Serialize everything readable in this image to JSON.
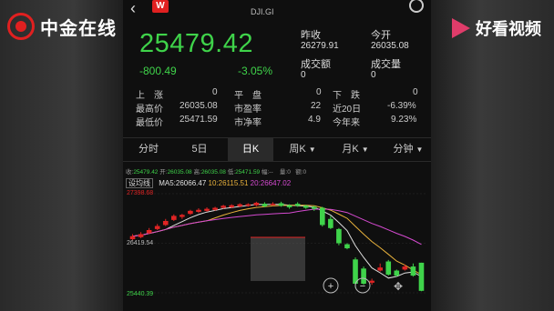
{
  "watermarks": {
    "left_text": "中金在线",
    "right_text": "好看视频"
  },
  "header": {
    "badge": "W",
    "symbol": "DJI.GI"
  },
  "quote": {
    "price": "25479.42",
    "change": "-800.49",
    "change_pct": "-3.05%",
    "prev_close_label": "昨收",
    "prev_close": "26279.91",
    "open_label": "今开",
    "open": "26035.08",
    "turnover_label": "成交额",
    "turnover": "0",
    "volume_label": "成交量",
    "volume": "0"
  },
  "stats": {
    "up_label": "上　涨",
    "up": "0",
    "flat_label": "平　盘",
    "flat": "0",
    "down_label": "下　跌",
    "down": "0",
    "high_label": "最高价",
    "high": "26035.08",
    "pe_label": "市盈率",
    "pe": "22",
    "d20_label": "近20日",
    "d20": "-6.39%",
    "low_label": "最低价",
    "low": "25471.59",
    "pb_label": "市净率",
    "pb": "4.9",
    "ytd_label": "今年来",
    "ytd": "9.23%"
  },
  "tabs": [
    {
      "label": "分时",
      "active": false
    },
    {
      "label": "5日",
      "active": false
    },
    {
      "label": "日K",
      "active": true
    },
    {
      "label": "周K",
      "active": false
    },
    {
      "label": "月K",
      "active": false
    },
    {
      "label": "分钟",
      "active": false
    }
  ],
  "kline_header": {
    "close_label": "收:",
    "close": "25479.42",
    "open_label": "开:",
    "open": "26035.08",
    "high_label": "高:",
    "high": "26035.08",
    "low_label": "低:",
    "low": "25471.59",
    "extra": "幅:--",
    "vol_label": "量:",
    "vol": "0",
    "amount_label": "额:",
    "amount": "0"
  },
  "ma": {
    "btn": "设均线",
    "ma5": "MA5:26066.47",
    "ma10": "10:26115.51",
    "ma20": "20:26647.02"
  },
  "chart_labels": {
    "top": "27398.68",
    "mid": "26419.54",
    "bottom": "25440.39"
  },
  "controls": {
    "zoom_in": "+",
    "zoom_out": "−"
  },
  "colors": {
    "up": "#e02424",
    "down": "#3fd34a",
    "ma5": "#e0e0e0",
    "ma10": "#e9b23c",
    "ma20": "#d54ad0",
    "accent": "#e02020"
  },
  "chart_data": {
    "type": "candlestick",
    "ylim": [
      25440.39,
      27398.68
    ],
    "labels": [
      "27398.68",
      "26419.54",
      "25440.39"
    ],
    "candles": [
      {
        "o": 26500,
        "c": 26560,
        "h": 26600,
        "l": 26480
      },
      {
        "o": 26540,
        "c": 26600,
        "h": 26640,
        "l": 26520
      },
      {
        "o": 26620,
        "c": 26680,
        "h": 26720,
        "l": 26600
      },
      {
        "o": 26700,
        "c": 26760,
        "h": 26800,
        "l": 26680
      },
      {
        "o": 26780,
        "c": 26860,
        "h": 26900,
        "l": 26760
      },
      {
        "o": 26880,
        "c": 26960,
        "h": 26990,
        "l": 26860
      },
      {
        "o": 26940,
        "c": 26980,
        "h": 27000,
        "l": 26900
      },
      {
        "o": 27000,
        "c": 27060,
        "h": 27080,
        "l": 26980
      },
      {
        "o": 27040,
        "c": 27080,
        "h": 27110,
        "l": 27020
      },
      {
        "o": 27060,
        "c": 27100,
        "h": 27130,
        "l": 27040
      },
      {
        "o": 27080,
        "c": 27120,
        "h": 27140,
        "l": 27060
      },
      {
        "o": 27120,
        "c": 27160,
        "h": 27180,
        "l": 27100
      },
      {
        "o": 27130,
        "c": 27170,
        "h": 27190,
        "l": 27110
      },
      {
        "o": 27150,
        "c": 27190,
        "h": 27210,
        "l": 27130
      },
      {
        "o": 27160,
        "c": 27190,
        "h": 27210,
        "l": 27140
      },
      {
        "o": 27170,
        "c": 27220,
        "h": 27240,
        "l": 27150
      },
      {
        "o": 27200,
        "c": 27150,
        "h": 27230,
        "l": 27130
      },
      {
        "o": 27180,
        "c": 27200,
        "h": 27230,
        "l": 27160
      },
      {
        "o": 27210,
        "c": 27160,
        "h": 27240,
        "l": 27140
      },
      {
        "o": 27170,
        "c": 27130,
        "h": 27190,
        "l": 27100
      },
      {
        "o": 27200,
        "c": 27160,
        "h": 27230,
        "l": 27140
      },
      {
        "o": 27160,
        "c": 27120,
        "h": 27180,
        "l": 27100
      },
      {
        "o": 27140,
        "c": 27100,
        "h": 27160,
        "l": 27060
      },
      {
        "o": 27120,
        "c": 26780,
        "h": 27140,
        "l": 26750
      },
      {
        "o": 26900,
        "c": 26720,
        "h": 26960,
        "l": 26700
      },
      {
        "o": 26700,
        "c": 26420,
        "h": 26720,
        "l": 26380
      },
      {
        "o": 26400,
        "c": 26320,
        "h": 26420,
        "l": 26300
      },
      {
        "o": 26100,
        "c": 25620,
        "h": 26140,
        "l": 25540
      },
      {
        "o": 25920,
        "c": 25620,
        "h": 25960,
        "l": 25600
      },
      {
        "o": 25640,
        "c": 25680,
        "h": 25720,
        "l": 25600
      },
      {
        "o": 25880,
        "c": 25940,
        "h": 26020,
        "l": 25860
      },
      {
        "o": 26060,
        "c": 25800,
        "h": 26090,
        "l": 25780
      },
      {
        "o": 25880,
        "c": 25780,
        "h": 25900,
        "l": 25760
      },
      {
        "o": 25900,
        "c": 25960,
        "h": 26000,
        "l": 25880
      },
      {
        "o": 25960,
        "c": 25780,
        "h": 26020,
        "l": 25760
      },
      {
        "o": 26035.08,
        "c": 25479.42,
        "h": 26035.08,
        "l": 25471.59
      }
    ]
  }
}
